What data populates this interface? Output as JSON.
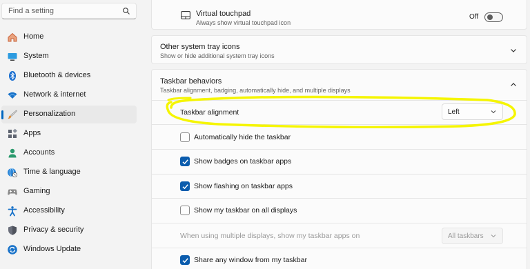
{
  "search": {
    "placeholder": "Find a setting",
    "icon": "search-icon"
  },
  "sidebar": {
    "items": [
      {
        "label": "Home",
        "icon": "home-icon",
        "color": "#e06b3a"
      },
      {
        "label": "System",
        "icon": "monitor-icon",
        "color": "#1f8fd6"
      },
      {
        "label": "Bluetooth & devices",
        "icon": "bluetooth-icon",
        "color": "#1a73c9"
      },
      {
        "label": "Network & internet",
        "icon": "wifi-icon",
        "color": "#1a73c9"
      },
      {
        "label": "Personalization",
        "icon": "brush-icon",
        "color": "#d98531",
        "active": true
      },
      {
        "label": "Apps",
        "icon": "apps-icon",
        "color": "#6b6f7b"
      },
      {
        "label": "Accounts",
        "icon": "person-icon",
        "color": "#2b9a6d"
      },
      {
        "label": "Time & language",
        "icon": "globe-clock-icon",
        "color": "#1a73c9"
      },
      {
        "label": "Gaming",
        "icon": "gamepad-icon",
        "color": "#7a7a7a"
      },
      {
        "label": "Accessibility",
        "icon": "accessibility-icon",
        "color": "#1a73c9"
      },
      {
        "label": "Privacy & security",
        "icon": "shield-icon",
        "color": "#6b6f7b"
      },
      {
        "label": "Windows Update",
        "icon": "update-icon",
        "color": "#1a73c9"
      }
    ]
  },
  "content": {
    "virtual_touchpad": {
      "title": "Virtual touchpad",
      "desc": "Always show virtual touchpad icon",
      "toggle_label": "Off",
      "toggle_on": false
    },
    "tray_icons": {
      "title": "Other system tray icons",
      "desc": "Show or hide additional system tray icons"
    },
    "behaviors": {
      "title": "Taskbar behaviors",
      "desc": "Taskbar alignment, badging, automatically hide, and multiple displays",
      "alignment_label": "Taskbar alignment",
      "alignment_value": "Left",
      "options": [
        {
          "label": "Automatically hide the taskbar",
          "checked": false
        },
        {
          "label": "Show badges on taskbar apps",
          "checked": true
        },
        {
          "label": "Show flashing on taskbar apps",
          "checked": true
        },
        {
          "label": "Show my taskbar on all displays",
          "checked": false
        }
      ],
      "multi_display_label": "When using multiple displays, show my taskbar apps on",
      "multi_display_value": "All taskbars",
      "share_label": "Share any window from my taskbar",
      "share_checked": true
    }
  },
  "annotation_color": "#f5f500"
}
